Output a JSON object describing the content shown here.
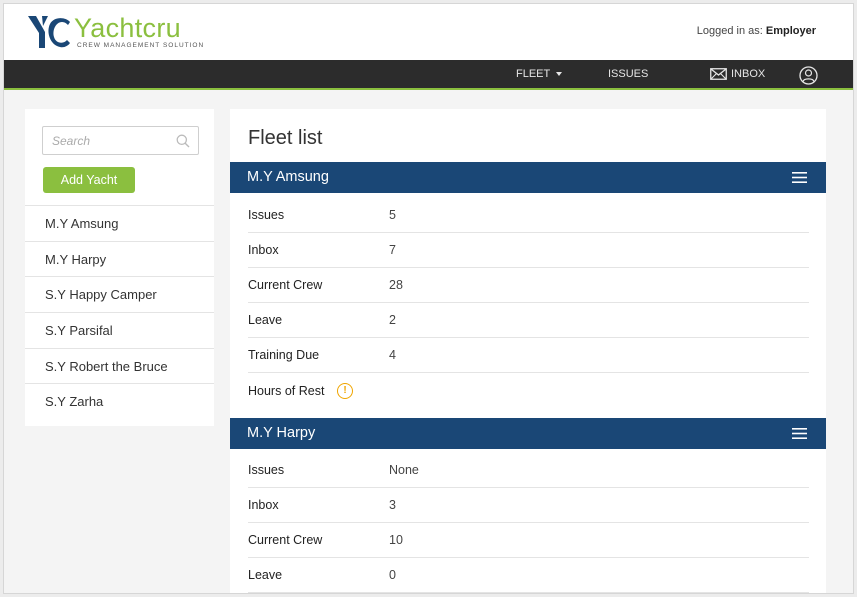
{
  "brand": {
    "name": "Yachtcru",
    "tagline": "CREW MANAGEMENT SOLUTION",
    "accent": "#8bbf3f",
    "mark_color": "#1a4776"
  },
  "header": {
    "login_prefix": "Logged in as:",
    "login_role": "Employer"
  },
  "nav": {
    "fleet": "FLEET",
    "issues": "ISSUES",
    "inbox": "INBOX",
    "inbox_icon": "envelope-icon",
    "user_icon": "user-icon"
  },
  "sidebar": {
    "search_placeholder": "Search",
    "add_button": "Add Yacht",
    "yachts": [
      "M.Y Amsung",
      "M.Y Harpy",
      "S.Y Happy Camper",
      "S.Y Parsifal",
      "S.Y Robert the Bruce",
      "S.Y Zarha"
    ]
  },
  "main": {
    "title": "Fleet list",
    "header_color": "#1a4776",
    "cards": [
      {
        "name": "M.Y Amsung",
        "rows": [
          {
            "label": "Issues",
            "value": "5"
          },
          {
            "label": "Inbox",
            "value": "7"
          },
          {
            "label": "Current Crew",
            "value": "28"
          },
          {
            "label": "Leave",
            "value": "2"
          },
          {
            "label": "Training Due",
            "value": "4"
          },
          {
            "label": "Hours of Rest",
            "value": ""
          }
        ]
      },
      {
        "name": "M.Y Harpy",
        "rows": [
          {
            "label": "Issues",
            "value": "None"
          },
          {
            "label": "Inbox",
            "value": "3"
          },
          {
            "label": "Current Crew",
            "value": "10"
          },
          {
            "label": "Leave",
            "value": "0"
          }
        ]
      }
    ]
  }
}
